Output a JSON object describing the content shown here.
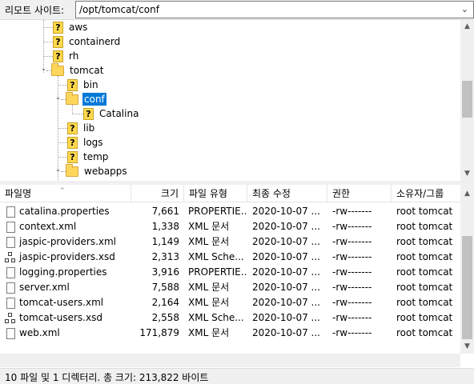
{
  "site": {
    "label": "리모트 사이트:",
    "path": "/opt/tomcat/conf",
    "dropdown_icon": "chevron-down-icon"
  },
  "tree": {
    "items": [
      {
        "label": "aws",
        "icon": "unknown-folder-icon"
      },
      {
        "label": "containerd",
        "icon": "unknown-folder-icon"
      },
      {
        "label": "rh",
        "icon": "unknown-folder-icon"
      },
      {
        "label": "tomcat",
        "icon": "folder-icon"
      },
      {
        "label": "bin",
        "icon": "unknown-folder-icon"
      },
      {
        "label": "conf",
        "icon": "folder-icon",
        "selected": true
      },
      {
        "label": "Catalina",
        "icon": "unknown-folder-icon"
      },
      {
        "label": "lib",
        "icon": "unknown-folder-icon"
      },
      {
        "label": "logs",
        "icon": "unknown-folder-icon"
      },
      {
        "label": "temp",
        "icon": "unknown-folder-icon"
      },
      {
        "label": "webapps",
        "icon": "folder-icon"
      }
    ]
  },
  "list": {
    "headers": {
      "name": "파일명",
      "size": "크기",
      "type": "파일 유형",
      "modified": "최종 수정",
      "perms": "권한",
      "owner": "소유자/그룹"
    },
    "rows": [
      {
        "name": "catalina.properties",
        "size": "7,661",
        "type": "PROPERTIE...",
        "modified": "2020-10-07 ...",
        "perms": "-rw-------",
        "owner": "root tomcat",
        "icon": "file-icon"
      },
      {
        "name": "context.xml",
        "size": "1,338",
        "type": "XML 문서",
        "modified": "2020-10-07 ...",
        "perms": "-rw-------",
        "owner": "root tomcat",
        "icon": "file-icon"
      },
      {
        "name": "jaspic-providers.xml",
        "size": "1,149",
        "type": "XML 문서",
        "modified": "2020-10-07 ...",
        "perms": "-rw-------",
        "owner": "root tomcat",
        "icon": "file-icon"
      },
      {
        "name": "jaspic-providers.xsd",
        "size": "2,313",
        "type": "XML Sche...",
        "modified": "2020-10-07 ...",
        "perms": "-rw-------",
        "owner": "root tomcat",
        "icon": "schema-icon"
      },
      {
        "name": "logging.properties",
        "size": "3,916",
        "type": "PROPERTIE...",
        "modified": "2020-10-07 ...",
        "perms": "-rw-------",
        "owner": "root tomcat",
        "icon": "file-icon"
      },
      {
        "name": "server.xml",
        "size": "7,588",
        "type": "XML 문서",
        "modified": "2020-10-07 ...",
        "perms": "-rw-------",
        "owner": "root tomcat",
        "icon": "file-icon"
      },
      {
        "name": "tomcat-users.xml",
        "size": "2,164",
        "type": "XML 문서",
        "modified": "2020-10-07 ...",
        "perms": "-rw-------",
        "owner": "root tomcat",
        "icon": "file-icon"
      },
      {
        "name": "tomcat-users.xsd",
        "size": "2,558",
        "type": "XML Sche...",
        "modified": "2020-10-07 ...",
        "perms": "-rw-------",
        "owner": "root tomcat",
        "icon": "schema-icon"
      },
      {
        "name": "web.xml",
        "size": "171,879",
        "type": "XML 문서",
        "modified": "2020-10-07 ...",
        "perms": "-rw-------",
        "owner": "root tomcat",
        "icon": "file-icon"
      }
    ]
  },
  "status": "10 파일 및 1 디렉터리. 총 크기: 213,822 바이트",
  "colors": {
    "selection": "#0078d7",
    "folder": "#ffd65c"
  }
}
